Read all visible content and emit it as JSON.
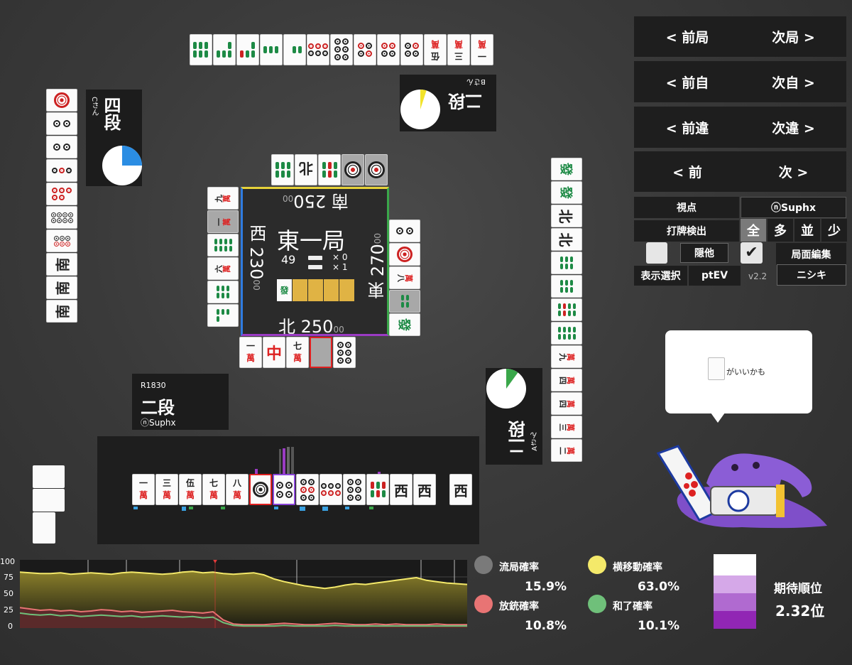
{
  "nav": {
    "prev_round": "< 前局",
    "next_round": "次局 >",
    "prev_self": "< 前自",
    "next_self": "次自 >",
    "prev_diff": "< 前違",
    "next_diff": "次違 >",
    "prev": "< 前",
    "next": "次 >"
  },
  "settings": {
    "viewpoint_label": "視点",
    "viewpoint_value": "ⓝSuphx",
    "discard_detect_label": "打牌検出",
    "detect_options": [
      "全",
      "多",
      "並",
      "少"
    ],
    "hide_others_label": "隠他",
    "edit_label": "局面編集",
    "display_select_label": "表示選択",
    "display_value": "ptEV",
    "version": "v2.2",
    "nickname": "ニシキ"
  },
  "center": {
    "round": "東一局",
    "tiles_left": "49",
    "honba": "× 0",
    "riichi": "× 1",
    "scores": {
      "south": "南 250",
      "south_sub": "00",
      "west": "西 230",
      "west_sub": "00",
      "east": "東 270",
      "east_sub": "00",
      "north": "北 250",
      "north_sub": "00"
    }
  },
  "players": {
    "self": {
      "rating": "R1830",
      "rank": "二段",
      "name": "ⓝSuphx"
    },
    "left": {
      "rank": "四段",
      "name": "Cさん",
      "win_fraction": 0.25
    },
    "top": {
      "rank": "二段",
      "name": "Bさん",
      "win_fraction": 0.05
    },
    "right": {
      "rank": "二段",
      "name": "Aさん",
      "win_fraction": 0.1
    }
  },
  "speech": {
    "text": "がいいかも"
  },
  "stats": {
    "ryukyoku_label": "流局確率",
    "ryukyoku_value": "15.9%",
    "yokoido_label": "横移動確率",
    "yokoido_value": "63.0%",
    "houju_label": "放銃確率",
    "houju_value": "10.8%",
    "hora_label": "和了確率",
    "hora_value": "10.1%",
    "expected_rank_label": "期待順位",
    "expected_rank_value": "2.32位"
  },
  "colors": {
    "ryukyoku": "#7a7a7a",
    "yokoido": "#f4e96a",
    "houju": "#e87474",
    "hora": "#6fc07a"
  },
  "chart_data": {
    "type": "area",
    "y_ticks": [
      "100",
      "75",
      "50",
      "25",
      "0"
    ],
    "ylim": [
      0,
      100
    ],
    "series": [
      {
        "values": [
          82,
          81,
          80,
          80,
          81,
          79,
          80,
          81,
          80,
          79,
          81,
          82,
          81,
          80,
          79,
          80,
          82,
          83,
          81,
          82,
          80,
          79,
          80,
          81,
          78,
          72,
          68,
          65,
          62,
          60,
          58,
          60,
          63,
          65,
          64,
          66,
          68,
          70,
          72,
          74,
          70,
          68,
          66,
          65,
          64
        ]
      },
      {
        "values": [
          30,
          28,
          26,
          27,
          25,
          26,
          24,
          25,
          27,
          26,
          24,
          25,
          23,
          24,
          25,
          26,
          24,
          23,
          22,
          24,
          12,
          6,
          5,
          5,
          5,
          6,
          7,
          6,
          5,
          5,
          6,
          7,
          6,
          5,
          5,
          6,
          5,
          6,
          5,
          5,
          5,
          6,
          5,
          5,
          5
        ]
      },
      {
        "values": [
          22,
          20,
          19,
          20,
          18,
          19,
          17,
          18,
          19,
          18,
          17,
          18,
          16,
          17,
          18,
          17,
          16,
          17,
          15,
          16,
          8,
          4,
          3,
          3,
          3,
          3,
          4,
          3,
          3,
          3,
          3,
          4,
          3,
          3,
          3,
          3,
          3,
          3,
          3,
          3,
          3,
          3,
          3,
          3,
          3
        ]
      }
    ]
  }
}
